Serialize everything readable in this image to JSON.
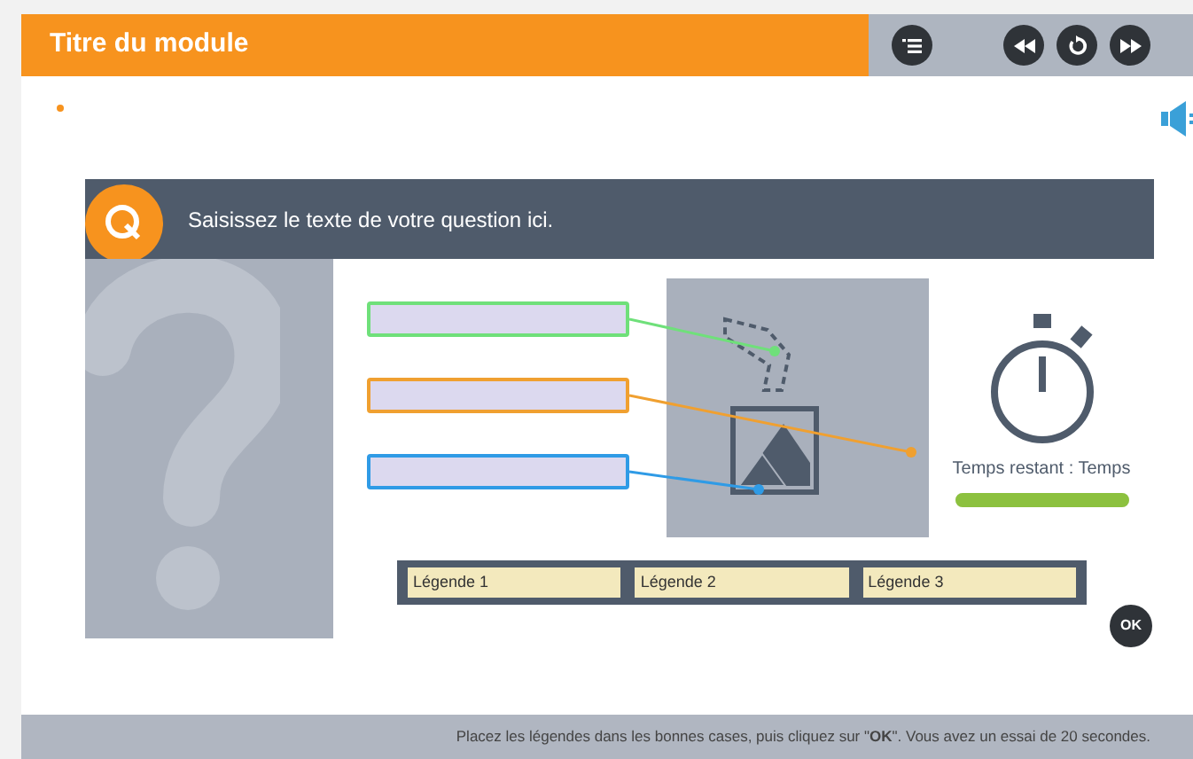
{
  "header": {
    "title": "Titre du module"
  },
  "question": {
    "text": "Saisissez le texte de votre question ici."
  },
  "drop_zones": [
    {
      "color": "#6fe07a"
    },
    {
      "color": "#f0a030"
    },
    {
      "color": "#2f9be6"
    }
  ],
  "legends": [
    "Légende 1",
    "Légende 2",
    "Légende 3"
  ],
  "timer": {
    "label": "Temps restant : Temps",
    "level": 1
  },
  "ok_button": "OK",
  "footer": {
    "instruction": "Placez les légendes dans les bonnes cases, puis cliquez sur \"**OK**\". Vous avez un essai de 20 secondes."
  }
}
